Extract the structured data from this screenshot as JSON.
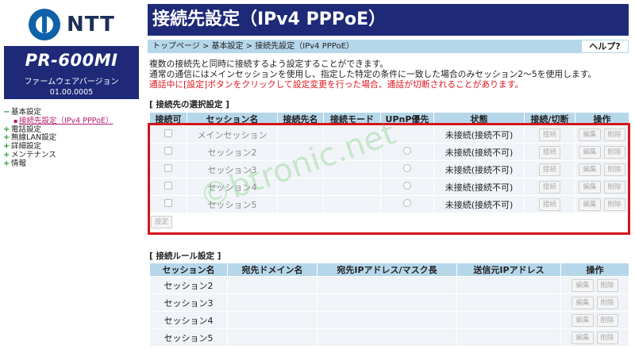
{
  "brand": {
    "logo_text": "NTT",
    "model": "PR-600MI",
    "firmware_label": "ファームウェアバージョン",
    "firmware_version": "01.00.0005"
  },
  "nav": {
    "items": [
      {
        "label": "基本設定",
        "icon": "minus"
      },
      {
        "label": "電話設定",
        "icon": "plus"
      },
      {
        "label": "無線LAN設定",
        "icon": "plus"
      },
      {
        "label": "詳細設定",
        "icon": "plus"
      },
      {
        "label": "メンテナンス",
        "icon": "plus"
      },
      {
        "label": "情報",
        "icon": "plus"
      }
    ],
    "sub_item": "接続先設定（IPv4 PPPoE）"
  },
  "page": {
    "title": "接続先設定（IPv4 PPPoE）",
    "breadcrumb": "トップページ > 基本設定 > 接続先設定（IPv4 PPPoE）",
    "help": "ヘルプ?",
    "desc1": "複数の接続先と同時に接続するよう設定することができます。",
    "desc2": "通常の通信にはメインセッションを使用し、指定した特定の条件に一致した場合のみセッション2〜5を使用します。",
    "warn": "通話中に[設定]ボタンをクリックして設定変更を行った場合、通話が切断されることがあります。"
  },
  "selection": {
    "title": "[ 接続先の選択設定 ]",
    "headers": [
      "接続可",
      "セッション名",
      "接続先名",
      "接続モード",
      "UPnP優先",
      "状態",
      "接続/切断",
      "操作"
    ],
    "rows": [
      {
        "session": "メインセッション",
        "status": "未接続(接続不可)",
        "has_radio": false
      },
      {
        "session": "セッション2",
        "status": "未接続(接続不可)",
        "has_radio": true
      },
      {
        "session": "セッション3",
        "status": "未接続(接続不可)",
        "has_radio": true
      },
      {
        "session": "セッション4",
        "status": "未接続(接続不可)",
        "has_radio": true
      },
      {
        "session": "セッション5",
        "status": "未接続(接続不可)",
        "has_radio": true
      }
    ],
    "connect_btn": "接続",
    "edit_btn": "編集",
    "delete_btn": "削除",
    "set_btn": "設定"
  },
  "rules": {
    "title": "[ 接続ルール設定 ]",
    "headers": [
      "セッション名",
      "宛先ドメイン名",
      "宛先IPアドレス/マスク長",
      "送信元IPアドレス",
      "操作"
    ],
    "rows": [
      {
        "session": "セッション2"
      },
      {
        "session": "セッション3"
      },
      {
        "session": "セッション4"
      },
      {
        "session": "セッション5"
      }
    ],
    "edit_btn": "編集",
    "delete_btn": "削除"
  },
  "watermark": "©btronic.net",
  "colors": {
    "header_bg": "#1e2a78",
    "table_header": "#b6d7ea",
    "row_bg": "#f0f4f8",
    "warning": "#e0141c",
    "highlight": "#d4141c"
  }
}
